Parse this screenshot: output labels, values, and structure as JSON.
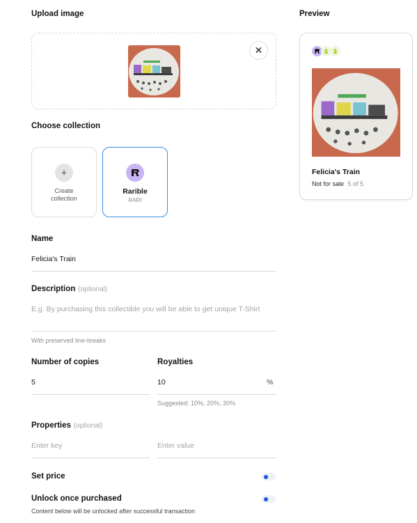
{
  "upload": {
    "title": "Upload image",
    "close_glyph": "✕"
  },
  "collection": {
    "title": "Choose collection",
    "create_label": "Create collection",
    "plus_glyph": "+",
    "rarible_name": "Rarible",
    "rarible_ticker": "RARI"
  },
  "name": {
    "label": "Name",
    "value": "Felicia's Train"
  },
  "description": {
    "label": "Description",
    "optional": "(optional)",
    "placeholder": "E.g. By purchasing this collectible you will be able to get unique T-Shirt",
    "hint": "With preserved line-breaks"
  },
  "copies": {
    "label": "Number of copies",
    "value": "5"
  },
  "royalties": {
    "label": "Royalties",
    "value": "10",
    "suffix": "%",
    "hint": "Suggested: 10%, 20%, 30%"
  },
  "properties": {
    "label": "Properties",
    "optional": "(optional)",
    "key_placeholder": "Enter key",
    "value_placeholder": "Enter value"
  },
  "set_price": {
    "label": "Set price",
    "enabled": false
  },
  "unlock": {
    "label": "Unlock once purchased",
    "hint": "Content below will be unlocked after successful transaction",
    "enabled": false
  },
  "preview": {
    "title": "Preview",
    "item_name": "Felicia's Train",
    "status": "Not for sale",
    "edition": "5 of 5"
  },
  "colors": {
    "accent": "#3a8ddf",
    "toggle_knob": "#1f55e0",
    "artwork_bg": "#c8694d"
  }
}
